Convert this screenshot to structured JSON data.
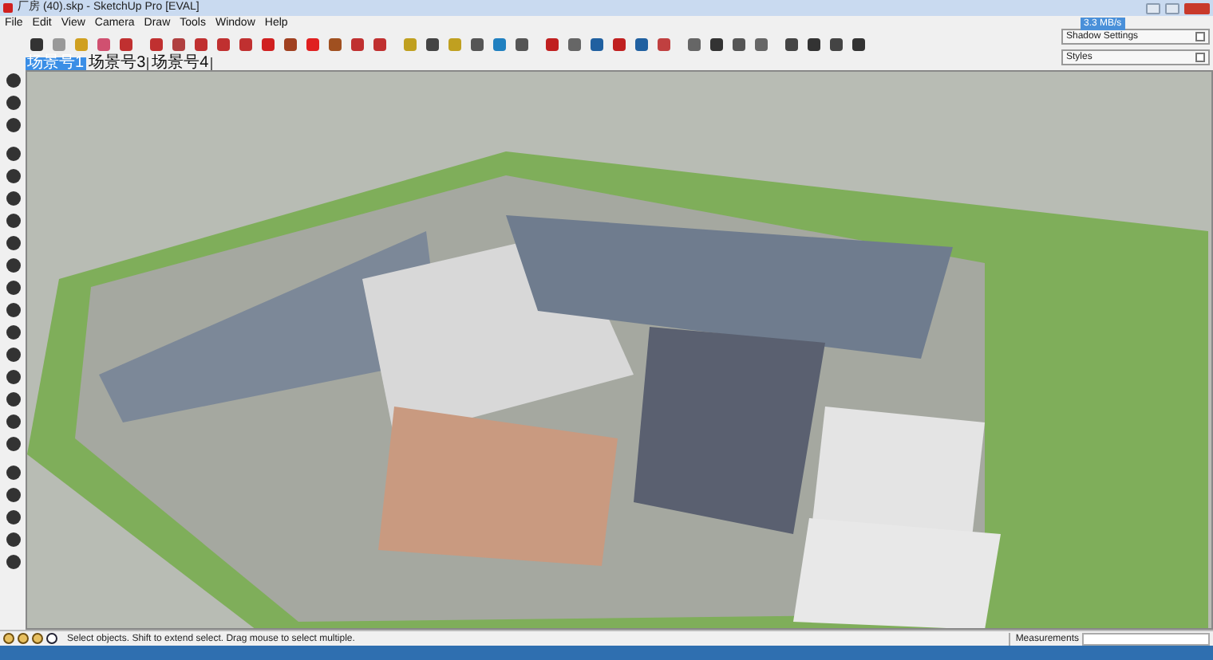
{
  "window": {
    "title": "厂房 (40).skp - SketchUp Pro [EVAL]"
  },
  "menu": [
    "File",
    "Edit",
    "View",
    "Camera",
    "Draw",
    "Tools",
    "Window",
    "Help"
  ],
  "scene_tabs": [
    {
      "label": "场景号1",
      "selected": true
    },
    {
      "label": "场景号3",
      "selected": false
    },
    {
      "label": "场景号4",
      "selected": false
    }
  ],
  "network_badge": "3.3 MB/s",
  "trays": [
    {
      "title": "Shadow Settings"
    },
    {
      "title": "Styles"
    }
  ],
  "status_bar": {
    "hint": "Select objects. Shift to extend select. Drag mouse to select multiple.",
    "measurements_label": "Measurements"
  }
}
